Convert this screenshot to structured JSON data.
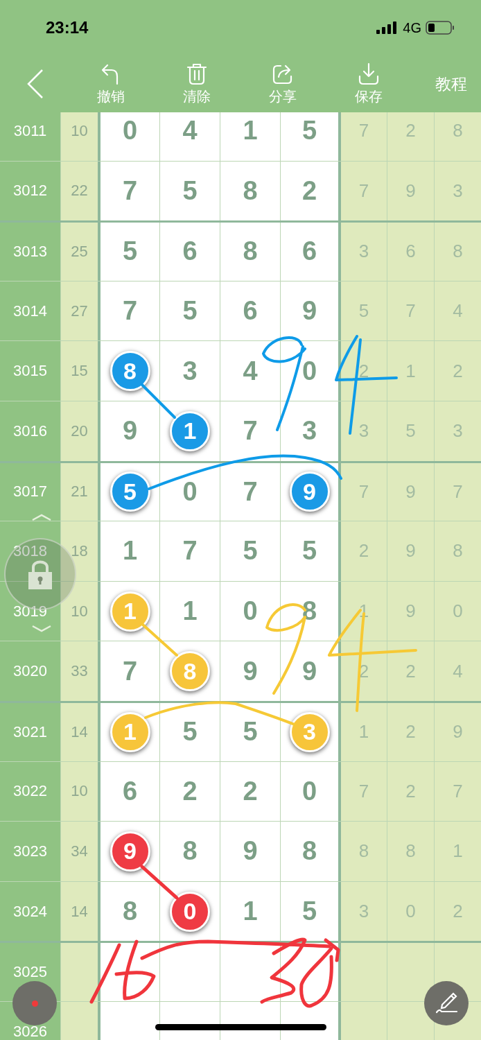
{
  "status_bar": {
    "time": "23:14",
    "network": "4G"
  },
  "toolbar": {
    "items": [
      {
        "kind": "undo",
        "label": "撤销"
      },
      {
        "kind": "clear",
        "label": "清除"
      },
      {
        "kind": "share",
        "label": "分享"
      },
      {
        "kind": "save",
        "label": "保存"
      }
    ],
    "tutorial": "教程"
  },
  "rows": [
    {
      "issue": "3011",
      "sum": "10",
      "digits": [
        {
          "v": "0"
        },
        {
          "v": "4"
        },
        {
          "v": "1"
        },
        {
          "v": "5"
        }
      ],
      "extra": [
        "7",
        "2",
        "8"
      ]
    },
    {
      "issue": "3012",
      "sum": "22",
      "digits": [
        {
          "v": "7"
        },
        {
          "v": "5"
        },
        {
          "v": "8"
        },
        {
          "v": "2"
        }
      ],
      "extra": [
        "7",
        "9",
        "3"
      ]
    },
    {
      "issue": "3013",
      "sum": "25",
      "digits": [
        {
          "v": "5"
        },
        {
          "v": "6"
        },
        {
          "v": "8"
        },
        {
          "v": "6"
        }
      ],
      "extra": [
        "3",
        "6",
        "8"
      ]
    },
    {
      "issue": "3014",
      "sum": "27",
      "digits": [
        {
          "v": "7"
        },
        {
          "v": "5"
        },
        {
          "v": "6"
        },
        {
          "v": "9"
        }
      ],
      "extra": [
        "5",
        "7",
        "4"
      ]
    },
    {
      "issue": "3015",
      "sum": "15",
      "digits": [
        {
          "v": "8",
          "color": "#1a9ae6"
        },
        {
          "v": "3"
        },
        {
          "v": "4"
        },
        {
          "v": "0"
        }
      ],
      "extra": [
        "2",
        "1",
        "2"
      ]
    },
    {
      "issue": "3016",
      "sum": "20",
      "digits": [
        {
          "v": "9"
        },
        {
          "v": "1",
          "color": "#1a9ae6"
        },
        {
          "v": "7"
        },
        {
          "v": "3"
        }
      ],
      "extra": [
        "3",
        "5",
        "3"
      ]
    },
    {
      "issue": "3017",
      "sum": "21",
      "digits": [
        {
          "v": "5",
          "color": "#1a9ae6"
        },
        {
          "v": "0"
        },
        {
          "v": "7"
        },
        {
          "v": "9",
          "color": "#1a9ae6"
        }
      ],
      "extra": [
        "7",
        "9",
        "7"
      ]
    },
    {
      "issue": "3018",
      "sum": "18",
      "digits": [
        {
          "v": "1"
        },
        {
          "v": "7"
        },
        {
          "v": "5"
        },
        {
          "v": "5"
        }
      ],
      "extra": [
        "2",
        "9",
        "8"
      ]
    },
    {
      "issue": "3019",
      "sum": "10",
      "digits": [
        {
          "v": "1",
          "color": "#f7c53a"
        },
        {
          "v": "1"
        },
        {
          "v": "0"
        },
        {
          "v": "8"
        }
      ],
      "extra": [
        "1",
        "9",
        "0"
      ]
    },
    {
      "issue": "3020",
      "sum": "33",
      "digits": [
        {
          "v": "7"
        },
        {
          "v": "8",
          "color": "#f7c53a"
        },
        {
          "v": "9"
        },
        {
          "v": "9"
        }
      ],
      "extra": [
        "2",
        "2",
        "4"
      ]
    },
    {
      "issue": "3021",
      "sum": "14",
      "digits": [
        {
          "v": "1",
          "color": "#f7c53a"
        },
        {
          "v": "5"
        },
        {
          "v": "5"
        },
        {
          "v": "3",
          "color": "#f7c53a"
        }
      ],
      "extra": [
        "1",
        "2",
        "9"
      ]
    },
    {
      "issue": "3022",
      "sum": "10",
      "digits": [
        {
          "v": "6"
        },
        {
          "v": "2"
        },
        {
          "v": "2"
        },
        {
          "v": "0"
        }
      ],
      "extra": [
        "7",
        "2",
        "7"
      ]
    },
    {
      "issue": "3023",
      "sum": "34",
      "digits": [
        {
          "v": "9",
          "color": "#ef3b44"
        },
        {
          "v": "8"
        },
        {
          "v": "9"
        },
        {
          "v": "8"
        }
      ],
      "extra": [
        "8",
        "8",
        "1"
      ]
    },
    {
      "issue": "3024",
      "sum": "14",
      "digits": [
        {
          "v": "8"
        },
        {
          "v": "0",
          "color": "#ef3b44"
        },
        {
          "v": "1"
        },
        {
          "v": "5"
        }
      ],
      "extra": [
        "3",
        "0",
        "2"
      ]
    },
    {
      "issue": "3025"
    },
    {
      "issue": "3026"
    }
  ]
}
